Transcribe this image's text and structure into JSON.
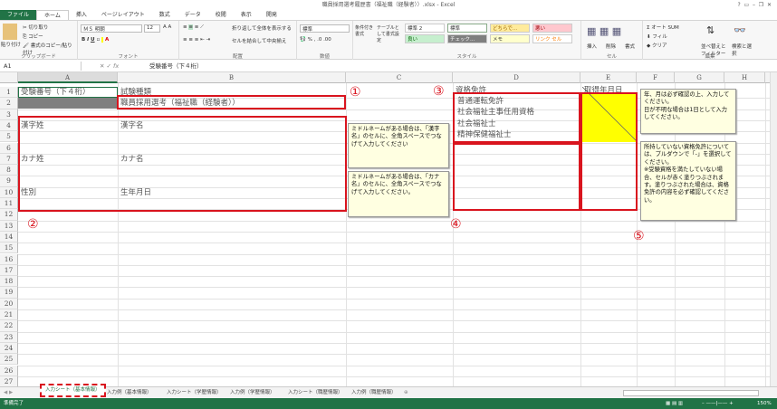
{
  "app": {
    "title": "職員採用選考履歴書（福祉職（経験者））.xlsx - Excel"
  },
  "tabs": [
    "ファイル",
    "ホーム",
    "挿入",
    "ページレイアウト",
    "数式",
    "データ",
    "校閲",
    "表示",
    "開発"
  ],
  "ribbon": {
    "clipboard": {
      "paste": "貼り付け",
      "cut": "切り取り",
      "copy": "コピー",
      "format_painter": "書式のコピー/貼り付け",
      "label": "クリップボード"
    },
    "font": {
      "name": "ＭＳ 明朝",
      "size": "12",
      "label": "フォント"
    },
    "alignment": {
      "wrap": "折り返して全体を表示する",
      "merge": "セルを結合して中央揃え",
      "label": "配置"
    },
    "number": {
      "format": "標準",
      "label": "数値"
    },
    "styles": {
      "conditional": "条件付き書式",
      "table": "テーブルとして書式設定",
      "items": [
        "標準 2",
        "標準",
        "どちらで...",
        "悪い",
        "良い",
        "チェック...",
        "メモ",
        "リンク セル"
      ],
      "label": "スタイル"
    },
    "cells": {
      "insert": "挿入",
      "delete": "削除",
      "format": "書式",
      "label": "セル"
    },
    "editing": {
      "autosum": "オート SUM",
      "fill": "フィル",
      "clear": "クリア",
      "sort": "並べ替えとフィルター",
      "find": "検索と選択",
      "label": "編集"
    }
  },
  "formula_bar": {
    "name_box": "A1",
    "fx": "fx",
    "value": "受験番号（下４桁）"
  },
  "columns": [
    "A",
    "B",
    "C",
    "D",
    "E",
    "F",
    "G",
    "H"
  ],
  "cells": {
    "A1": "受験番号（下４桁）",
    "B1": "試験種類",
    "B2": "職員採用選考（福祉職（経験者））",
    "A4": "漢字姓",
    "B4": "漢字名",
    "A7": "カナ姓",
    "B7": "カナ名",
    "A10": "性別",
    "B10": "生年月日",
    "D1": "資格免許",
    "E1": "取得年月日",
    "D2": "普通運転免許",
    "D3": "社会福祉主事任用資格",
    "D4": "社会福祉士",
    "D5": "精神保健福祉士"
  },
  "annotations": [
    "①",
    "②",
    "③",
    "④",
    "⑤"
  ],
  "notes": [
    "ミドルネームがある場合は、「漢字名」のセルに、全角スペースでつなげて入力してください",
    "ミドルネームがある場合は、「カナ名」のセルに、全角スペースでつなげて入力してください。",
    "年、月は必ず確認の上、入力してください。\n日が不明な場合は1日として入力してください。",
    "所持していない資格免許については、プルダウンで「-」を選択してください。\n※受験資格を満たしていない場合、セルが赤く塗りつぶされます。塗りつぶされた場合は、資格免許の内容を必ず確認してください。"
  ],
  "sheet_tabs": [
    "入力シート（基本情報）",
    "入力例（基本情報）",
    "入力シート（学歴情報）",
    "入力例（学歴情報）",
    "入力シート（職歴情報）",
    "入力例（職歴情報）"
  ],
  "status": {
    "ready": "準備完了",
    "zoom": "150%"
  },
  "colors": {
    "excel_green": "#217346",
    "red": "#d9141e",
    "yellow": "#ffff00",
    "note": "#ffffe1"
  }
}
